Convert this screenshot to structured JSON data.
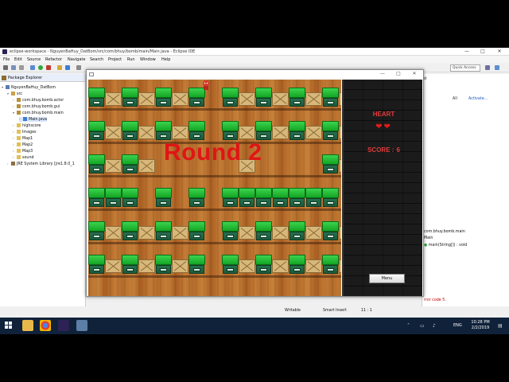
{
  "eclipse": {
    "title": "eclipse-workspace - NguyenBaHuy_DatBom/src/com/bhuy/bomb/main/Main.java - Eclipse IDE",
    "window_buttons": [
      "—",
      "□",
      "✕"
    ],
    "menu": [
      "File",
      "Edit",
      "Source",
      "Refactor",
      "Navigate",
      "Search",
      "Project",
      "Run",
      "Window",
      "Help"
    ],
    "quick_access": "Quick Access"
  },
  "package_explorer": {
    "title": "Package Explorer",
    "tree": [
      {
        "label": "NguyenBaHuy_DatBom",
        "icon": "project-icon"
      },
      {
        "label": "src",
        "icon": "source-folder-icon"
      },
      {
        "label": "com.bhuy.bomb.actor",
        "icon": "package-icon"
      },
      {
        "label": "com.bhuy.bomb.gui",
        "icon": "package-icon"
      },
      {
        "label": "com.bhuy.bomb.main",
        "icon": "package-icon"
      },
      {
        "label": "Main.java",
        "icon": "java-file-icon"
      },
      {
        "label": "highscore",
        "icon": "folder-icon"
      },
      {
        "label": "Images",
        "icon": "folder-icon"
      },
      {
        "label": "Map1",
        "icon": "folder-icon"
      },
      {
        "label": "Map2",
        "icon": "folder-icon"
      },
      {
        "label": "Map3",
        "icon": "folder-icon"
      },
      {
        "label": "sound",
        "icon": "folder-icon"
      },
      {
        "label": "JRE System Library [jre1.8.0_1",
        "icon": "library-icon"
      }
    ]
  },
  "outline": {
    "tab_fragment": "st",
    "all_label": "All",
    "activate_label": "Activate...",
    "package": "com.bhuy.bomb.main",
    "class": "Main",
    "method": "main(String[]) : void"
  },
  "console": {
    "error_text": "rror code 5."
  },
  "status_bar": {
    "mode": "Writable",
    "insert": "Smart Insert",
    "position": "11 : 1"
  },
  "game": {
    "round_text": "Round 2",
    "heart_label": "HEART",
    "hearts": "❤❤",
    "lives": 2,
    "score_label": "SCORE :",
    "score_value": "6",
    "menu_button": "Menu",
    "colors": {
      "text_red": "#e23b3b",
      "round_red": "#e01515",
      "wall_green": "#13a624",
      "floor_wood": "#b56d2a"
    }
  },
  "taskbar": {
    "lang": "ENG",
    "time": "10:28 PM",
    "date": "2/2/2019"
  }
}
